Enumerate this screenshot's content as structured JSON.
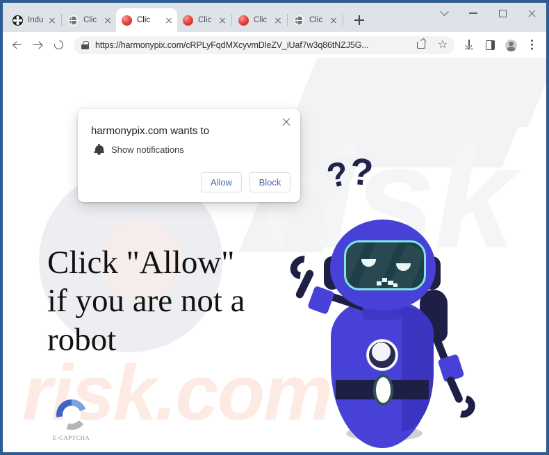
{
  "window": {
    "controls": [
      {
        "name": "tab-search",
        "icon": "chevron-down-icon",
        "label": "⌄"
      },
      {
        "name": "minimize",
        "icon": "minimize-icon",
        "label": "–"
      },
      {
        "name": "maximize",
        "icon": "maximize-icon",
        "label": "□"
      },
      {
        "name": "close",
        "icon": "close-icon",
        "label": "✕"
      }
    ]
  },
  "tabs": [
    {
      "title": "Indu",
      "favicon": "film-reel-icon",
      "active": false
    },
    {
      "title": "Clic",
      "favicon": "globe-icon",
      "active": false
    },
    {
      "title": "Clic",
      "favicon": "red-sphere-icon",
      "active": true
    },
    {
      "title": "Clic",
      "favicon": "red-sphere-icon",
      "active": false
    },
    {
      "title": "Clic",
      "favicon": "red-sphere-icon",
      "active": false
    },
    {
      "title": "Clic",
      "favicon": "globe-icon",
      "active": false
    }
  ],
  "new_tab_label": "+",
  "toolbar": {
    "back_icon": "back-arrow-icon",
    "forward_icon": "forward-arrow-icon",
    "reload_icon": "reload-icon",
    "lock_icon": "lock-icon",
    "url_scheme": "https://",
    "url_host": "harmonypix.com",
    "url_path": "/cRPLyFqdMXcyvmDleZV_iUaf7w3q86tNZJ5G...",
    "url_full": "https://harmonypix.com/cRPLyFqdMXcyvmDleZV_iUaf7w3q86tNZJ5G...",
    "actions": [
      {
        "name": "share-icon"
      },
      {
        "name": "bookmark-star-icon"
      },
      {
        "name": "download-icon"
      },
      {
        "name": "side-panel-icon"
      },
      {
        "name": "profile-avatar-icon"
      },
      {
        "name": "more-menu-icon"
      }
    ],
    "star_glyph": "☆"
  },
  "notification_dialog": {
    "title": "harmonypix.com wants to",
    "permission": "Show notifications",
    "bell_icon": "bell-icon",
    "close_icon": "close-icon",
    "allow_label": "Allow",
    "block_label": "Block",
    "accent_color": "#4a63bd"
  },
  "page": {
    "headline_line1": "Click \"Allow\"",
    "headline_line2": "if you are not a",
    "headline_line3": "robot",
    "captcha_label": "E-CAPTCHA",
    "watermark_top": "risk",
    "watermark_bottom": "risk.com",
    "question_mark_1": "?",
    "question_mark_2": "?",
    "colors": {
      "robot_body": "#4741d8",
      "robot_dark": "#1e1f45",
      "visor": "#1e3f47",
      "visor_border": "#7fe6e1",
      "shadow": "#d1d1d3",
      "watermark": "#fdeae3"
    }
  }
}
